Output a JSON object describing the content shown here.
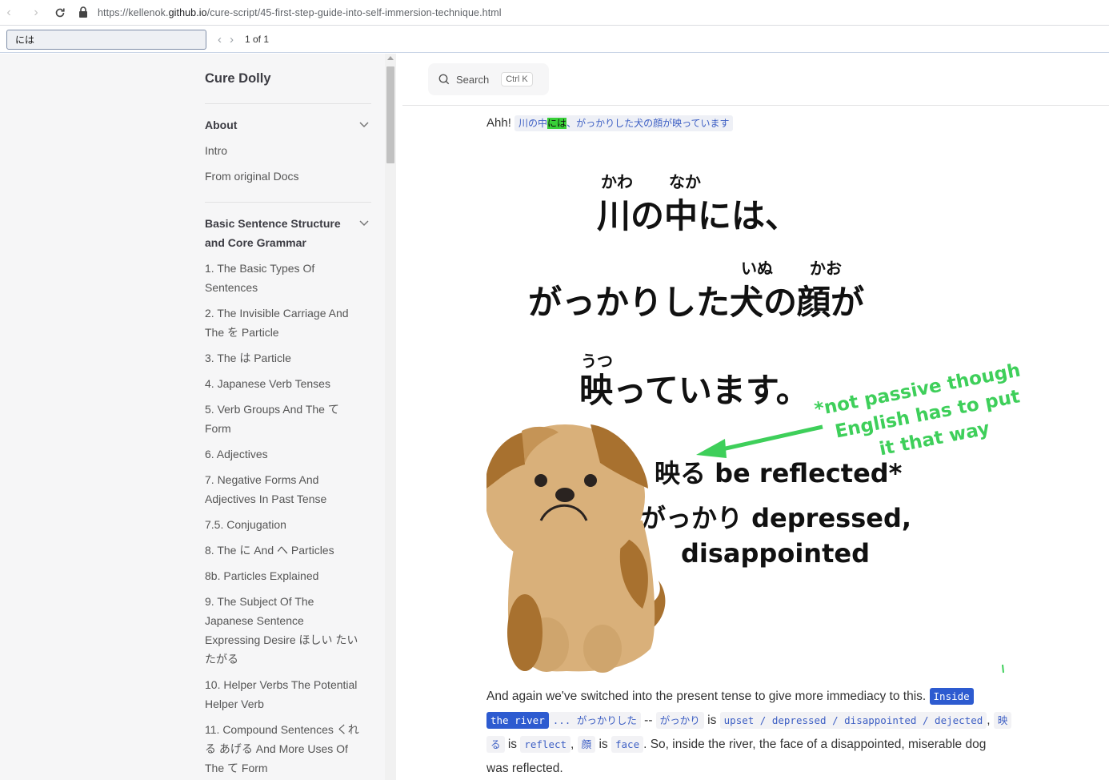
{
  "browser": {
    "url_prefix": "https://kellenok.",
    "url_domain": "github.io",
    "url_path": "/cure-script/45-first-step-guide-into-self-immersion-technique.html"
  },
  "find": {
    "query": "には",
    "count": "1 of 1"
  },
  "sidebar": {
    "brand": "Cure Dolly",
    "section1": {
      "title": "About",
      "items": [
        "Intro",
        "From original Docs"
      ]
    },
    "section2": {
      "title_line1": "Basic Sentence Structure",
      "title_line2": "and Core Grammar",
      "items": [
        [
          "1. The Basic Types Of",
          "Sentences"
        ],
        [
          "2. The Invisible Carriage And",
          "The を Particle"
        ],
        [
          "3. The は Particle"
        ],
        [
          "4. Japanese Verb Tenses"
        ],
        [
          "5. Verb Groups And The て",
          "Form"
        ],
        [
          "6. Adjectives"
        ],
        [
          "7. Negative Forms And",
          "Adjectives In Past Tense"
        ],
        [
          "7.5. Conjugation"
        ],
        [
          "8. The に And へ Particles"
        ],
        [
          "8b. Particles Explained"
        ],
        [
          "9. The Subject Of The",
          "Japanese Sentence",
          "Expressing Desire ほしい たい",
          "たがる"
        ],
        [
          "10. Helper Verbs The Potential",
          "Helper Verb"
        ],
        [
          "11. Compound Sentences くれ",
          "る あげる And More Uses Of",
          "The て Form"
        ]
      ]
    }
  },
  "search": {
    "label": "Search",
    "shortcut": "Ctrl K"
  },
  "content": {
    "p1_prefix": "Ahh!",
    "p1_link_a": "川の中",
    "p1_link_hl": "には",
    "p1_link_b": "、がっかりした犬の顔が映っています",
    "figure": {
      "ruby_kawa": "かわ",
      "ruby_naka": "なか",
      "line1": "川の中には、",
      "ruby_inu": "いぬ",
      "ruby_kao": "かお",
      "line2": "がっかりした犬の顔が",
      "ruby_utsu": "うつ",
      "line3": "映っています。",
      "note_line1": "*not passive though",
      "note_line2": "English has to put",
      "note_line3": "it that way",
      "gloss1": "映る be reflected*",
      "gloss2": "がっかり depressed,",
      "gloss3": "disappointed"
    },
    "p2": {
      "text1": "And again we've switched into the present tense to give more immediacy to this.",
      "sel1": "Inside",
      "sel2": "the river",
      "code1": "... がっかりした",
      "dashes": "--",
      "code2": "がっかり",
      "is1": "is",
      "code3": "upset / depressed / disappointed / dejected",
      "comma1": ",",
      "code4a": "映",
      "code4b": "る",
      "is2": "is",
      "code5": "reflect",
      "comma2": ",",
      "code6": "顔",
      "is3": "is",
      "code7": "face",
      "text2": ". So, inside the river, the face of a disappointed, miserable dog",
      "text3": "was reflected."
    }
  },
  "colors": {
    "link": "#3d5fc4",
    "find_highlight": "#38d038",
    "selection": "#2d5bd0",
    "arrow_green": "#3ecf5a",
    "dog_tan": "#d9b07a",
    "dog_brown": "#a8712f"
  }
}
